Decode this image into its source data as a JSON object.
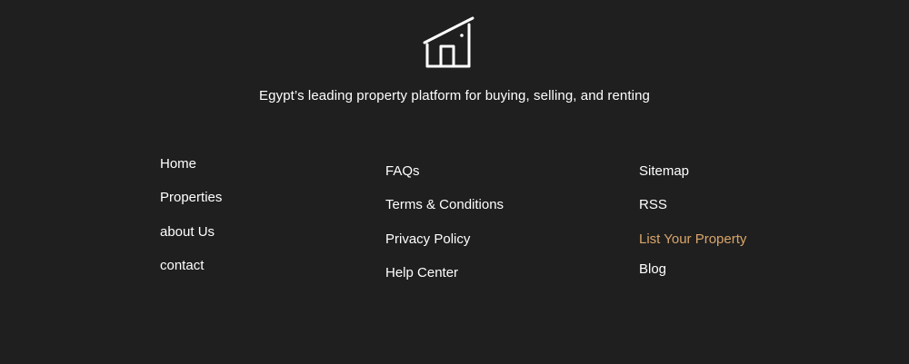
{
  "brand": {
    "logo_icon": "house-icon",
    "tagline": "Egypt’s leading property platform for buying, selling, and renting"
  },
  "colors": {
    "background": "#1f1f1f",
    "text": "#ffffff",
    "accent": "#d9a66b"
  },
  "footer": {
    "col1": {
      "links": [
        "Home",
        "Properties",
        "about Us",
        "contact"
      ]
    },
    "col2": {
      "links": [
        "FAQs",
        "Terms & Conditions",
        "Privacy Policy",
        "Help Center"
      ]
    },
    "col3": {
      "links": [
        "Sitemap",
        "RSS",
        "List Your Property",
        "Blog"
      ]
    }
  }
}
